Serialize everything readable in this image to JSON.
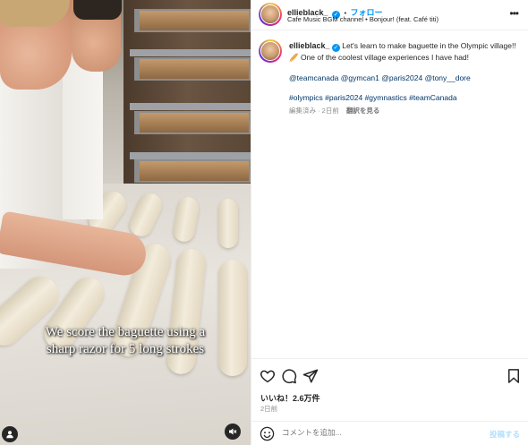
{
  "post": {
    "caption_line1": "We score the baguette using a",
    "caption_line2": "sharp razor for 5 long strokes"
  },
  "header": {
    "username": "ellieblack_",
    "dot": "•",
    "follow_label": "フォロー",
    "audio": "Cafe Music BGM channel • Bonjour! (feat. Café titi)",
    "more_label": "•••"
  },
  "caption": {
    "username": "ellieblack_",
    "text": "Let's learn to make baguette in the Olympic village!! 🥖 One of the coolest village experiences I have had!",
    "mentions": "@teamcanada @gymcan1 @paris2024 @tony__dore",
    "hashtags": "#olympics #paris2024 #gymnastics #teamCanada",
    "edited": "編集済み · 2日前",
    "translate": "翻訳を見る"
  },
  "engagement": {
    "likes": "いいね！2.6万件",
    "date": "2日前"
  },
  "composer": {
    "placeholder": "コメントを追加...",
    "post_label": "投稿する"
  },
  "colors": {
    "accent": "#0095f6",
    "link": "#00376b",
    "muted": "#8e8e8e"
  }
}
